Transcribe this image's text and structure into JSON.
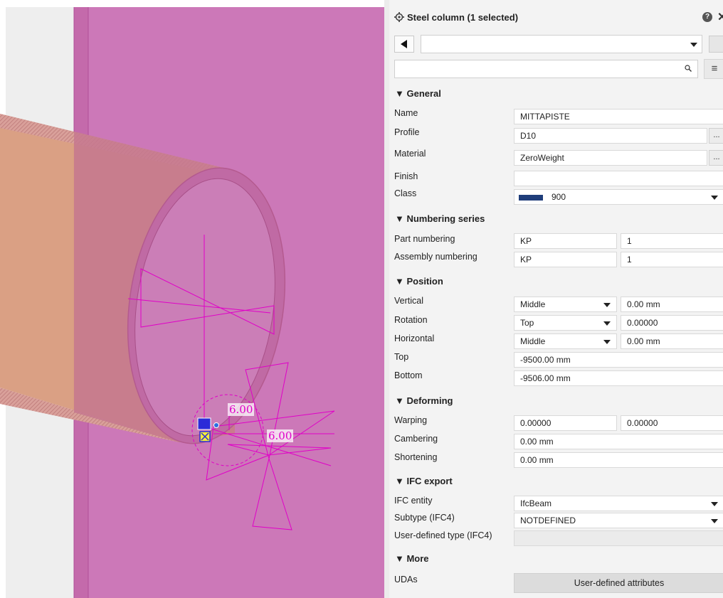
{
  "panel": {
    "title": "Steel column (1 selected)",
    "help_label": "?",
    "close_label": "✕",
    "menu_label": "≡"
  },
  "viewport": {
    "dim_label_1": "6.00",
    "dim_label_2": "6.00"
  },
  "sections": {
    "general": "▼ General",
    "numbering": "▼ Numbering series",
    "position": "▼ Position",
    "deforming": "▼ Deforming",
    "ifc": "▼ IFC export",
    "more": "▼ More"
  },
  "general": {
    "name_label": "Name",
    "name_value": "MITTAPISTE",
    "profile_label": "Profile",
    "profile_value": "D10",
    "material_label": "Material",
    "material_value": "ZeroWeight",
    "finish_label": "Finish",
    "finish_value": "",
    "class_label": "Class",
    "class_value": "900",
    "class_color": "#1f3d7a",
    "browse_label": "..."
  },
  "numbering": {
    "part_label": "Part numbering",
    "part_prefix": "KP",
    "part_start": "1",
    "assembly_label": "Assembly numbering",
    "assembly_prefix": "KP",
    "assembly_start": "1"
  },
  "position": {
    "vertical_label": "Vertical",
    "vertical_value": "Middle",
    "vertical_offset": "0.00 mm",
    "rotation_label": "Rotation",
    "rotation_value": "Top",
    "rotation_offset": "0.00000",
    "horizontal_label": "Horizontal",
    "horizontal_value": "Middle",
    "horizontal_offset": "0.00 mm",
    "top_label": "Top",
    "top_value": "-9500.00 mm",
    "bottom_label": "Bottom",
    "bottom_value": "-9506.00 mm"
  },
  "deforming": {
    "warping_label": "Warping",
    "warping_value1": "0.00000",
    "warping_value2": "0.00000",
    "cambering_label": "Cambering",
    "cambering_value": "0.00 mm",
    "shortening_label": "Shortening",
    "shortening_value": "0.00 mm"
  },
  "ifc": {
    "entity_label": "IFC entity",
    "entity_value": "IfcBeam",
    "subtype_label": "Subtype (IFC4)",
    "subtype_value": "NOTDEFINED",
    "user_type_label": "User-defined type (IFC4)",
    "user_type_value": ""
  },
  "more": {
    "udas_label": "UDAs",
    "uda_button": "User-defined attributes"
  }
}
